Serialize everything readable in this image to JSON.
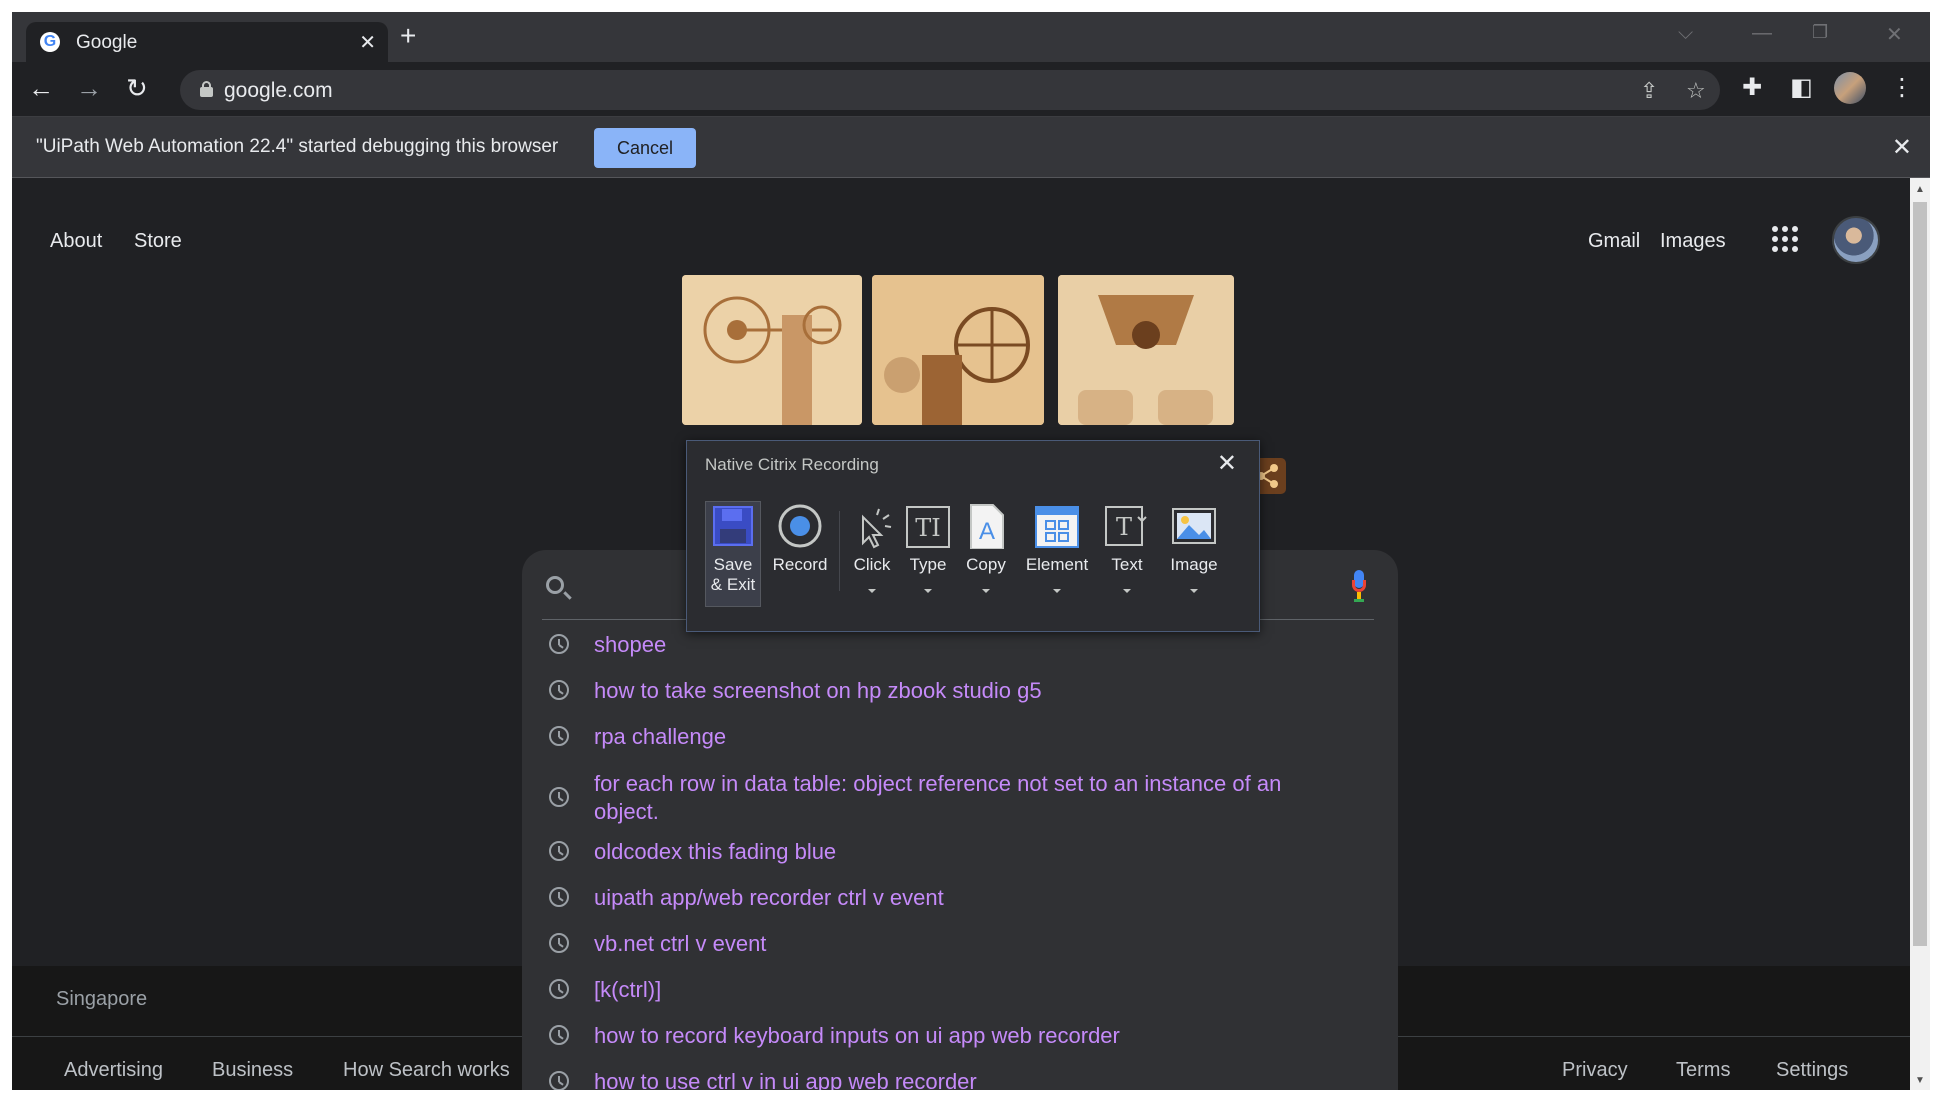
{
  "browser": {
    "tab": {
      "title": "Google",
      "favicon": "G"
    },
    "new_tab_glyph": "+",
    "url": "google.com",
    "icons": [
      "back-arrow-icon",
      "forward-arrow-icon",
      "reload-icon",
      "lock-icon",
      "share-icon",
      "star-icon",
      "extensions-icon",
      "side-panel-icon",
      "profile-avatar",
      "menu-icon"
    ]
  },
  "infobar": {
    "message": "\"UiPath Web Automation 22.4\" started debugging this browser",
    "cancel_label": "Cancel"
  },
  "google": {
    "top_left_links": [
      "About",
      "Store"
    ],
    "top_right_links": [
      "Gmail",
      "Images"
    ],
    "suggestions": [
      "shopee",
      "how to take screenshot on hp zbook studio g5",
      "rpa challenge",
      "for each row in data table: object reference not set to an instance of an object.",
      "oldcodex this fading blue",
      "uipath app/web recorder ctrl v event",
      "vb.net ctrl v event",
      "[k(ctrl)]",
      "how to record keyboard inputs on ui app web recorder",
      "how to use ctrl v in ui app web recorder"
    ],
    "footer": {
      "location": "Singapore",
      "left_links": [
        "Advertising",
        "Business",
        "How Search works"
      ],
      "right_links": [
        "Privacy",
        "Terms",
        "Settings"
      ]
    }
  },
  "citrix_recorder": {
    "title": "Native Citrix Recording",
    "buttons": {
      "save_exit": "Save\n& Exit",
      "record": "Record",
      "click": "Click",
      "type": "Type",
      "copy": "Copy",
      "element": "Element",
      "text": "Text",
      "image": "Image"
    },
    "accent_color": "#4a8fe7"
  },
  "colors": {
    "page_bg": "#202124",
    "suggestion_text": "#c58af9",
    "cancel_button": "#8ab4f8"
  }
}
